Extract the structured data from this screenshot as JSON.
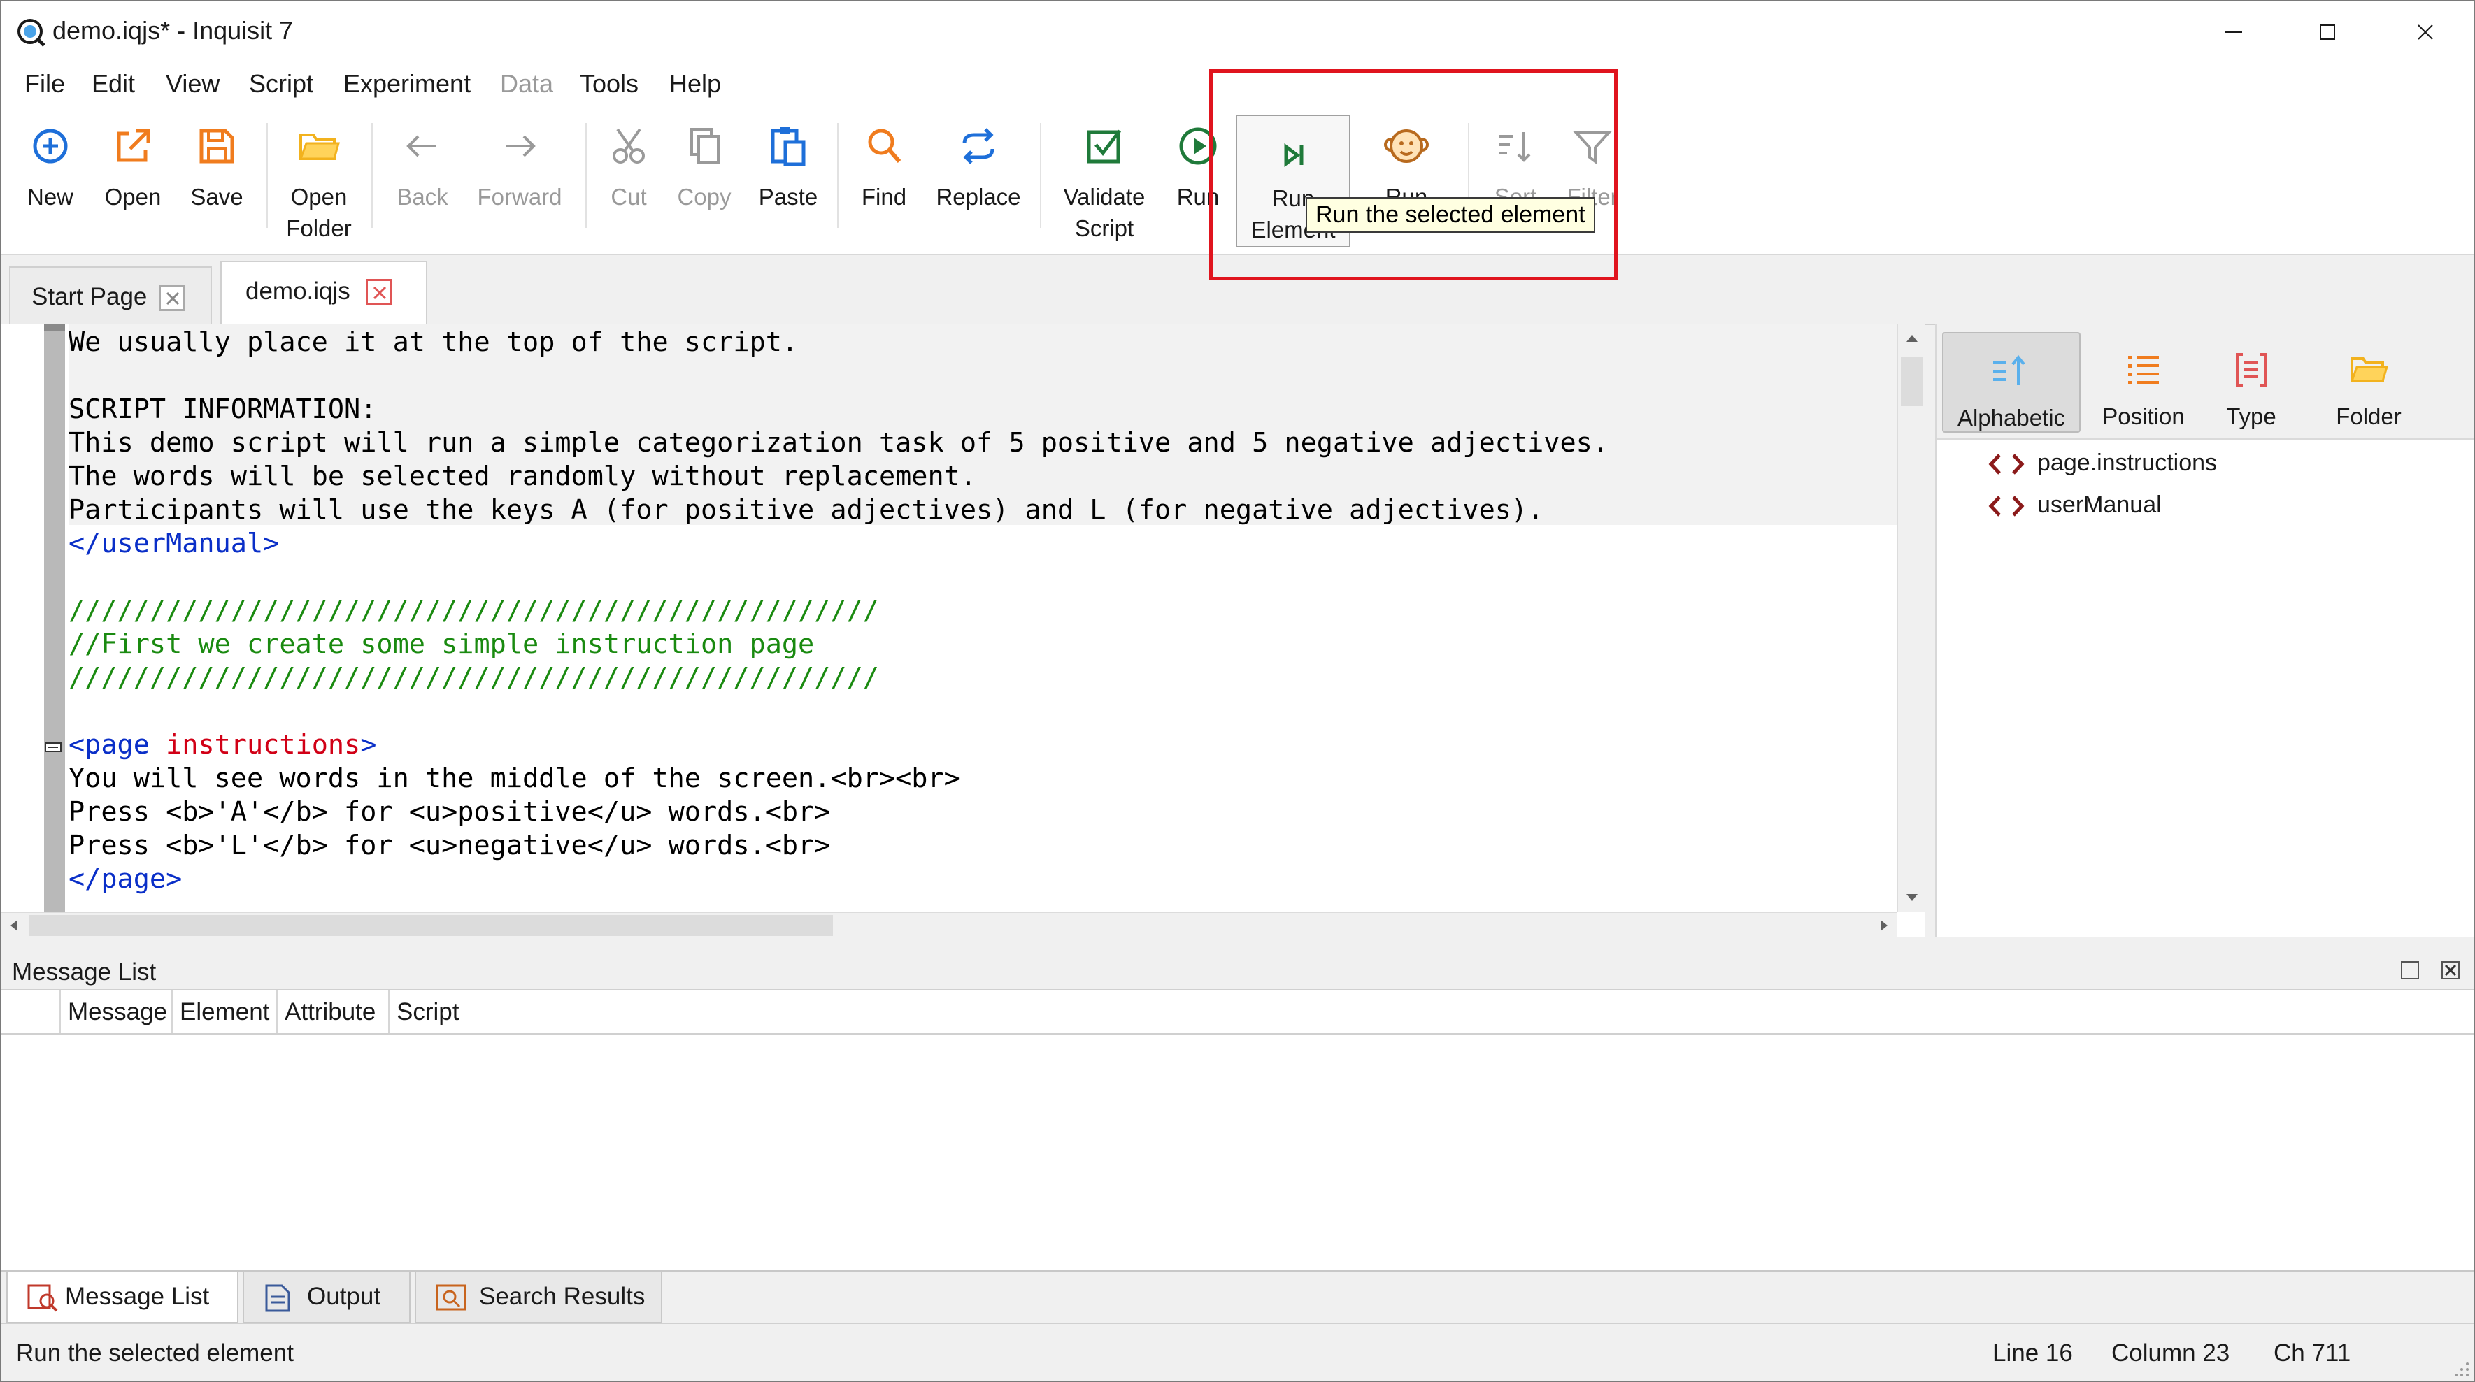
{
  "window": {
    "title": "demo.iqjs* - Inquisit 7"
  },
  "menu": [
    {
      "label": "File",
      "enabled": true
    },
    {
      "label": "Edit",
      "enabled": true
    },
    {
      "label": "View",
      "enabled": true
    },
    {
      "label": "Script",
      "enabled": true
    },
    {
      "label": "Experiment",
      "enabled": true
    },
    {
      "label": "Data",
      "enabled": false
    },
    {
      "label": "Tools",
      "enabled": true
    },
    {
      "label": "Help",
      "enabled": true
    }
  ],
  "toolbar": {
    "new": "New",
    "open": "Open",
    "save": "Save",
    "open_folder": "Open\nFolder",
    "back": "Back",
    "forward": "Forward",
    "cut": "Cut",
    "copy": "Copy",
    "paste": "Paste",
    "find": "Find",
    "replace": "Replace",
    "validate": "Validate\nScript",
    "run": "Run",
    "run_element": "Run\nElement",
    "run_monkey": "Run",
    "sort": "Sort",
    "filter": "Filter"
  },
  "tooltip": "Run the selected element",
  "tabs": {
    "start_page": "Start Page",
    "demo": "demo.iqjs"
  },
  "editor": {
    "lines": {
      "l1": "We usually place it at the top of the script.",
      "l3": "SCRIPT INFORMATION:",
      "l4": "This demo script will run a simple categorization task of 5 positive and 5 negative adjectives.",
      "l5": "The words will be selected randomly without replacement.",
      "l6": "Participants will use the keys A (for positive adjectives) and L (for negative adjectives).",
      "l7": "</userManual>",
      "l9": "//////////////////////////////////////////////////",
      "l10": "//First we create some simple instruction page",
      "l11": "//////////////////////////////////////////////////",
      "l13_open": "<page ",
      "l13_name": "instructions",
      "l13_close": ">",
      "l14": "You will see words in the middle of the screen.<br><br>",
      "l15": "Press <b>'A'</b> for <u>positive</u> words.<br>",
      "l16": "Press <b>'L'</b> for <u>negative</u> words.<br>",
      "l17": "</page>"
    }
  },
  "element_panel": {
    "sort_buttons": {
      "alphabetic": "Alphabetic",
      "position": "Position",
      "type": "Type",
      "folder": "Folder"
    },
    "items": [
      "page.instructions",
      "userManual"
    ]
  },
  "message_list": {
    "title": "Message List",
    "columns": [
      "Message",
      "Element",
      "Attribute",
      "Script"
    ]
  },
  "bottom_tabs": {
    "message_list": "Message List",
    "output": "Output",
    "search_results": "Search Results"
  },
  "status": {
    "text": "Run the selected element",
    "line": "Line  16",
    "column": "Column  23",
    "ch": "Ch  711"
  },
  "colors": {
    "accent_blue": "#1e6fd9",
    "orange": "#f07c1e",
    "highlight_red": "#e0141e",
    "tag_blue": "#0a2fc8",
    "attr_red": "#d10016",
    "comment_green": "#1a8a10",
    "validate_green": "#1f7a3a"
  },
  "icons": {
    "new": "plus-circle-icon",
    "open": "open-external-icon",
    "save": "floppy-disk-icon",
    "open_folder": "folder-icon",
    "back": "arrow-left-icon",
    "forward": "arrow-right-icon",
    "cut": "scissors-icon",
    "copy": "copy-icon",
    "paste": "clipboard-icon",
    "find": "magnifier-icon",
    "replace": "swap-arrows-icon",
    "validate": "checkbox-icon",
    "run": "play-circle-icon",
    "run_element": "step-forward-icon",
    "run_monkey": "monkey-icon",
    "sort": "sort-icon",
    "filter": "funnel-icon"
  }
}
